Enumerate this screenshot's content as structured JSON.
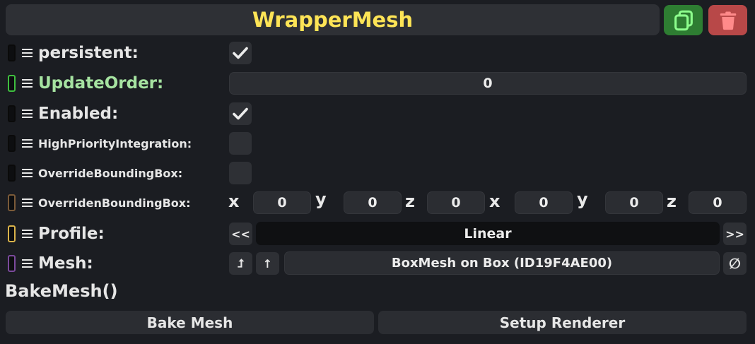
{
  "header": {
    "title": "WrapperMesh"
  },
  "colors": {
    "title": "#fde456",
    "update_order_label": "#a6e3a1",
    "indicator_update_order": "#3fbf3f",
    "indicator_overriden": "#7a5a38",
    "indicator_profile": "#d9b24a",
    "indicator_mesh": "#7b4a9c"
  },
  "icons": {
    "duplicate": "copy-icon",
    "delete": "trash-icon",
    "drag": "hamburger-icon",
    "check": "checkmark-icon",
    "prev": "double-chevron-left-icon",
    "next": "double-chevron-right-icon",
    "jump": "jump-to-icon",
    "up": "arrow-up-icon",
    "clear": "null-icon"
  },
  "fields": {
    "persistent": {
      "label": "persistent:",
      "checked": true
    },
    "update_order": {
      "label": "UpdateOrder:",
      "value": "0"
    },
    "enabled": {
      "label": "Enabled:",
      "checked": true
    },
    "high_priority": {
      "label": "HighPriorityIntegration:",
      "checked": false
    },
    "override_bbox": {
      "label": "OverrideBoundingBox:",
      "checked": false
    },
    "overriden_bbox": {
      "label": "OverridenBoundingBox:",
      "min": {
        "x_label": "x",
        "x": "0",
        "y_label": "y",
        "y": "0",
        "z_label": "z",
        "z": "0"
      },
      "max": {
        "x_label": "x",
        "x": "0",
        "y_label": "y",
        "y": "0",
        "z_label": "z",
        "z": "0"
      }
    },
    "profile": {
      "label": "Profile:",
      "value": "Linear",
      "prev": "<<",
      "next": ">>"
    },
    "mesh": {
      "label": "Mesh:",
      "value": "BoxMesh on Box (ID19F4AE00)",
      "jump": "⮥",
      "up": "↑",
      "clear": "∅"
    }
  },
  "method": {
    "label": "BakeMesh()"
  },
  "buttons": {
    "bake": "Bake Mesh",
    "setup": "Setup Renderer"
  }
}
